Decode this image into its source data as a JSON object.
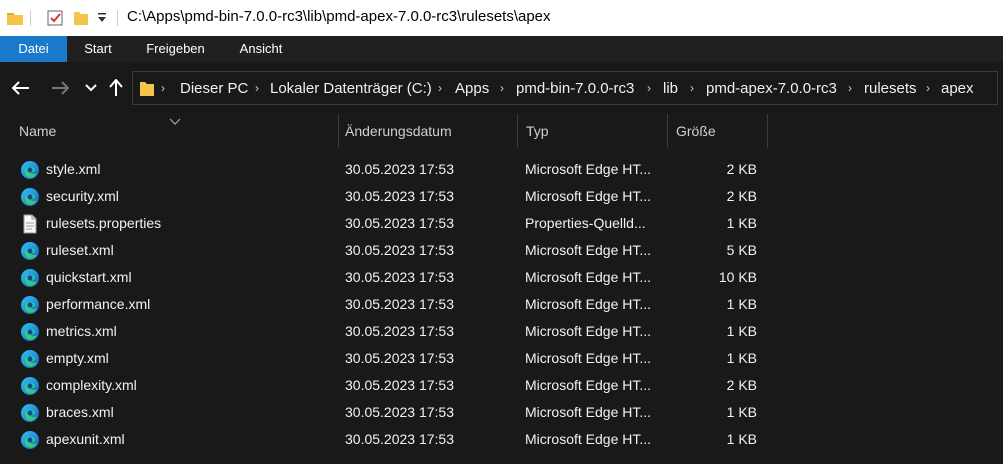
{
  "window": {
    "path_title": "C:\\Apps\\pmd-bin-7.0.0-rc3\\lib\\pmd-apex-7.0.0-rc3\\rulesets\\apex"
  },
  "ribbon": {
    "tabs": [
      "Datei",
      "Start",
      "Freigeben",
      "Ansicht"
    ]
  },
  "breadcrumbs": [
    "Dieser PC",
    "Lokaler Datenträger (C:)",
    "Apps",
    "pmd-bin-7.0.0-rc3",
    "lib",
    "pmd-apex-7.0.0-rc3",
    "rulesets",
    "apex"
  ],
  "columns": {
    "name": "Name",
    "date": "Änderungsdatum",
    "type": "Typ",
    "size": "Größe"
  },
  "files": [
    {
      "name": "style.xml",
      "date": "30.05.2023 17:53",
      "type": "Microsoft Edge HT...",
      "size": "2 KB",
      "icon": "edge-icon"
    },
    {
      "name": "security.xml",
      "date": "30.05.2023 17:53",
      "type": "Microsoft Edge HT...",
      "size": "2 KB",
      "icon": "edge-icon"
    },
    {
      "name": "rulesets.properties",
      "date": "30.05.2023 17:53",
      "type": "Properties-Quelld...",
      "size": "1 KB",
      "icon": "document-icon"
    },
    {
      "name": "ruleset.xml",
      "date": "30.05.2023 17:53",
      "type": "Microsoft Edge HT...",
      "size": "5 KB",
      "icon": "edge-icon"
    },
    {
      "name": "quickstart.xml",
      "date": "30.05.2023 17:53",
      "type": "Microsoft Edge HT...",
      "size": "10 KB",
      "icon": "edge-icon"
    },
    {
      "name": "performance.xml",
      "date": "30.05.2023 17:53",
      "type": "Microsoft Edge HT...",
      "size": "1 KB",
      "icon": "edge-icon"
    },
    {
      "name": "metrics.xml",
      "date": "30.05.2023 17:53",
      "type": "Microsoft Edge HT...",
      "size": "1 KB",
      "icon": "edge-icon"
    },
    {
      "name": "empty.xml",
      "date": "30.05.2023 17:53",
      "type": "Microsoft Edge HT...",
      "size": "1 KB",
      "icon": "edge-icon"
    },
    {
      "name": "complexity.xml",
      "date": "30.05.2023 17:53",
      "type": "Microsoft Edge HT...",
      "size": "2 KB",
      "icon": "edge-icon"
    },
    {
      "name": "braces.xml",
      "date": "30.05.2023 17:53",
      "type": "Microsoft Edge HT...",
      "size": "1 KB",
      "icon": "edge-icon"
    },
    {
      "name": "apexunit.xml",
      "date": "30.05.2023 17:53",
      "type": "Microsoft Edge HT...",
      "size": "1 KB",
      "icon": "edge-icon"
    }
  ],
  "colors": {
    "accent": "#1979ca",
    "background": "#191919",
    "folder": "#f4c54a"
  }
}
